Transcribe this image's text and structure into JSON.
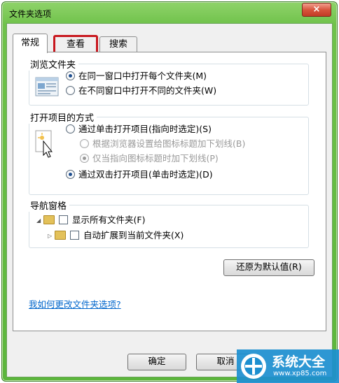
{
  "window": {
    "title": "文件夹选项",
    "close_label": "×"
  },
  "tabs": [
    {
      "label": "常规"
    },
    {
      "label": "查看"
    },
    {
      "label": "搜索"
    }
  ],
  "browse_group": {
    "title": "浏览文件夹",
    "options": [
      {
        "label": "在同一窗口中打开每个文件夹(M)",
        "checked": true
      },
      {
        "label": "在不同窗口中打开不同的文件夹(W)",
        "checked": false
      }
    ]
  },
  "open_group": {
    "title": "打开项目的方式",
    "options": [
      {
        "label": "通过单击打开项目(指向时选定)(S)",
        "checked": false
      },
      {
        "label": "根据浏览器设置给图标标题加下划线(B)",
        "checked": false,
        "disabled": true
      },
      {
        "label": "仅当指向图标标题时加下划线(P)",
        "checked": true,
        "disabled": true
      },
      {
        "label": "通过双击打开项目(单击时选定)(D)",
        "checked": true
      }
    ]
  },
  "nav_group": {
    "title": "导航窗格",
    "options": [
      {
        "label": "显示所有文件夹(F)"
      },
      {
        "label": "自动扩展到当前文件夹(X)"
      }
    ]
  },
  "restore_button": "还原为默认值(R)",
  "help_link": "我如何更改文件夹选项?",
  "buttons": {
    "ok": "确定",
    "cancel": "取消"
  },
  "watermark": {
    "site": "系统大全",
    "url": "www.xp85.com"
  }
}
